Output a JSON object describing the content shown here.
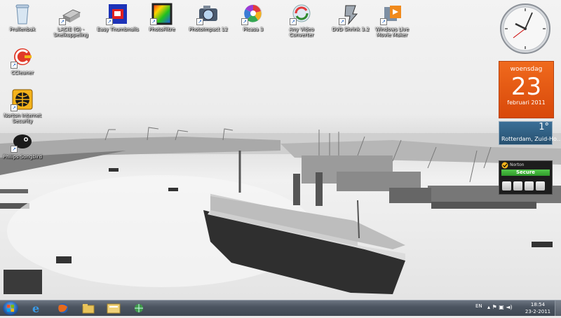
{
  "desktop": {
    "icons": [
      {
        "label": "Prullenbak"
      },
      {
        "label": "LACIE (G) - Snelkoppeling"
      },
      {
        "label": "Easy Thumbnails"
      },
      {
        "label": "PhotoFiltre"
      },
      {
        "label": "PhotoImpact 12"
      },
      {
        "label": "Picasa 3"
      },
      {
        "label": "Any Video Converter"
      },
      {
        "label": "DVD Shrink 3.2"
      },
      {
        "label": "Windows Live Movie Maker"
      },
      {
        "label": "CCleaner"
      },
      {
        "label": "Norton Internet Security"
      },
      {
        "label": "Philips Songbird"
      }
    ]
  },
  "gadgets": {
    "calendar": {
      "day_name": "woensdag",
      "day": "23",
      "month_year": "februari 2011"
    },
    "weather": {
      "temperature": "1°",
      "location": "Rotterdam, Zuid-Ho..."
    },
    "norton": {
      "brand": "Norton",
      "status": "Secure"
    }
  },
  "taskbar": {
    "language": "EN",
    "clock_time": "18:54",
    "clock_date": "23-2-2011"
  },
  "colors": {
    "calendar_accent": "#e0581a",
    "norton_status": "#3bb033"
  }
}
